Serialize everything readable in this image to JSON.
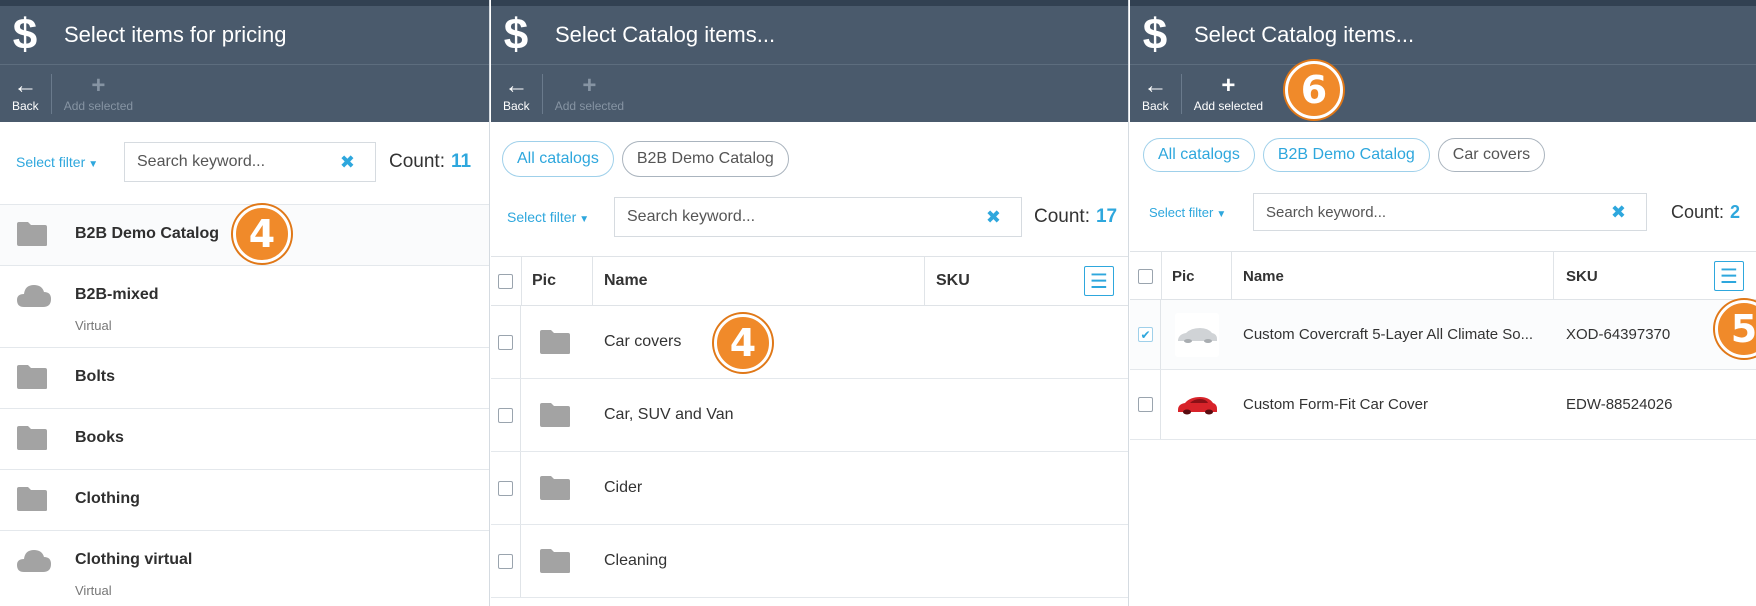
{
  "blade1": {
    "title": "Select items for pricing",
    "toolbar": {
      "back_label": "Back",
      "add_label": "Add selected"
    },
    "filter": {
      "label": "Select filter",
      "search_placeholder": "Search keyword...",
      "count_label": "Count:",
      "count": "11"
    },
    "badge": "4",
    "items": [
      {
        "name": "B2B Demo Catalog",
        "subtitle": "",
        "icon": "folder-icon"
      },
      {
        "name": "B2B-mixed",
        "subtitle": "Virtual",
        "icon": "cloud-icon"
      },
      {
        "name": "Bolts",
        "subtitle": "",
        "icon": "folder-icon"
      },
      {
        "name": "Books",
        "subtitle": "",
        "icon": "folder-icon"
      },
      {
        "name": "Clothing",
        "subtitle": "",
        "icon": "folder-icon"
      },
      {
        "name": "Clothing virtual",
        "subtitle": "Virtual",
        "icon": "cloud-icon"
      }
    ]
  },
  "blade2": {
    "title": "Select Catalog items...",
    "toolbar": {
      "back_label": "Back",
      "add_label": "Add selected"
    },
    "breadcrumbs": [
      "All catalogs",
      "B2B Demo Catalog"
    ],
    "filter": {
      "label": "Select filter",
      "search_placeholder": "Search keyword...",
      "count_label": "Count:",
      "count": "17"
    },
    "columns": {
      "pic": "Pic",
      "name": "Name",
      "sku": "SKU"
    },
    "badge": "4",
    "rows": [
      {
        "name": "Car covers",
        "sku": ""
      },
      {
        "name": "Car, SUV and Van",
        "sku": ""
      },
      {
        "name": "Cider",
        "sku": ""
      },
      {
        "name": "Cleaning",
        "sku": ""
      }
    ]
  },
  "blade3": {
    "title": "Select Catalog items...",
    "toolbar": {
      "back_label": "Back",
      "add_label": "Add selected"
    },
    "breadcrumbs": [
      "All catalogs",
      "B2B Demo Catalog",
      "Car covers"
    ],
    "filter": {
      "label": "Select filter",
      "search_placeholder": "Search keyword...",
      "count_label": "Count:",
      "count": "2"
    },
    "columns": {
      "pic": "Pic",
      "name": "Name",
      "sku": "SKU"
    },
    "badge_add": "6",
    "badge_row": "5",
    "rows": [
      {
        "name": "Custom Covercraft 5-Layer All Climate So...",
        "sku": "XOD-64397370",
        "checked": true,
        "thumb": "silver-car-cover-thumbnail"
      },
      {
        "name": "Custom Form-Fit Car Cover",
        "sku": "EDW-88524026",
        "checked": false,
        "thumb": "red-car-cover-thumbnail"
      }
    ]
  },
  "colors": {
    "header": "#4a5a6c",
    "accent": "#2ea7dd",
    "badge": "#f08a2a"
  }
}
